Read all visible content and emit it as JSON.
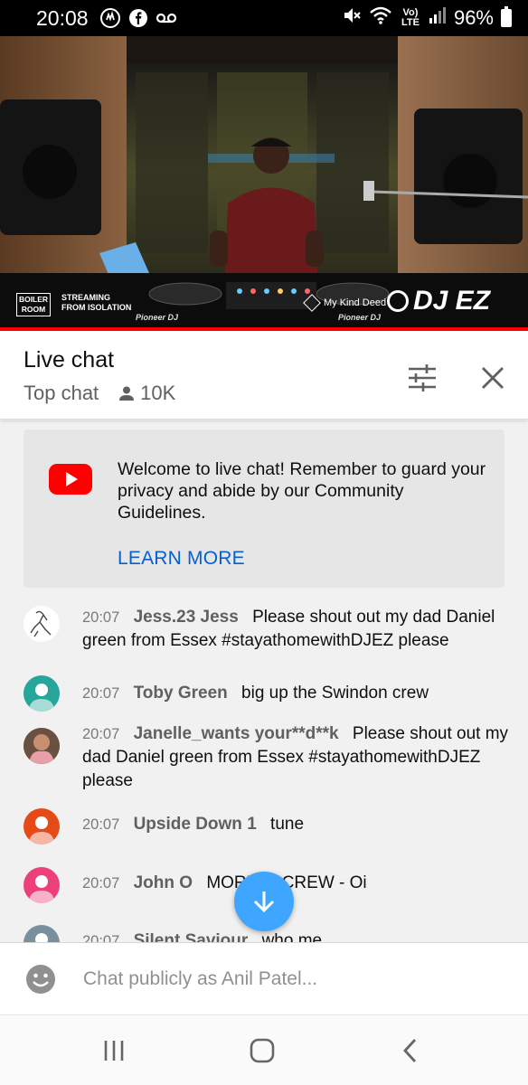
{
  "status_bar": {
    "time": "20:08",
    "network": "Vo) LTE",
    "battery": "96%",
    "icons": [
      "hand-icon",
      "facebook-icon",
      "voicemail-icon",
      "mute-icon",
      "wifi-icon",
      "signal-icon",
      "battery-icon"
    ]
  },
  "video": {
    "brand_left_line1": "BOILER",
    "brand_left_line2": "ROOM",
    "streaming_line1": "STREAMING",
    "streaming_line2": "FROM ISOLATION",
    "sponsor": "My Kind Deed",
    "artist": "DJ EZ",
    "mixer_brand": "Pioneer DJ"
  },
  "chat_header": {
    "title": "Live chat",
    "mode": "Top chat",
    "viewers": "10K"
  },
  "welcome": {
    "message": "Welcome to live chat! Remember to guard your privacy and abide by our Community Guidelines.",
    "link": "LEARN MORE"
  },
  "messages": [
    {
      "time": "20:07",
      "author": "Jess.23 Jess",
      "text": "Please shout out my dad Daniel green from Essex #stayathomewithDJEZ please",
      "avatar": "drawing-avatar"
    },
    {
      "time": "20:07",
      "author": "Toby Green",
      "text": "big up the Swindon crew",
      "avatar": "default-avatar",
      "color": "#26a69a"
    },
    {
      "time": "20:07",
      "author": "Janelle_wants your**d**k",
      "text": "Please shout out my dad Daniel green from Essex #stayathomewithDJEZ please",
      "avatar": "photo-avatar"
    },
    {
      "time": "20:07",
      "author": "Upside Down 1",
      "text": "tune",
      "avatar": "default-avatar",
      "color": "#e64a19"
    },
    {
      "time": "20:07",
      "author": "John O",
      "text": "MORE ... CREW - Oi",
      "avatar": "default-avatar",
      "color": "#ec407a"
    },
    {
      "time": "20:07",
      "author": "Silent Saviour",
      "text": "who me",
      "avatar": "default-avatar",
      "color": "#78909c"
    }
  ],
  "chat_input": {
    "placeholder": "Chat publicly as Anil Patel..."
  },
  "colors": {
    "accent_blue": "#065fd4",
    "fab_blue": "#3ea6ff",
    "youtube_red": "#ff0000"
  }
}
